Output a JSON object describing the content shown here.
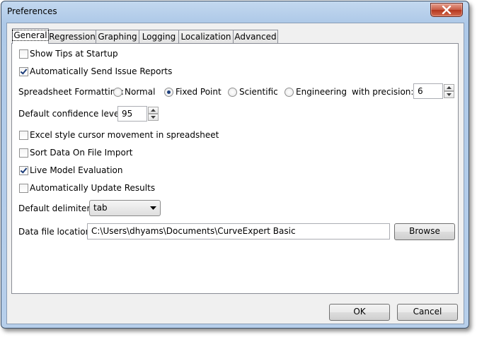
{
  "window": {
    "title": "Preferences"
  },
  "tabs": [
    {
      "label": "General",
      "active": true
    },
    {
      "label": "Regression",
      "active": false
    },
    {
      "label": "Graphing",
      "active": false
    },
    {
      "label": "Logging",
      "active": false
    },
    {
      "label": "Localization",
      "active": false
    },
    {
      "label": "Advanced",
      "active": false
    }
  ],
  "general": {
    "show_tips": {
      "label": "Show Tips at Startup",
      "checked": false
    },
    "send_reports": {
      "label": "Automatically Send Issue Reports",
      "checked": true
    },
    "spreadsheet_formatting": {
      "label": "Spreadsheet Formatting:",
      "options": [
        {
          "label": "Normal",
          "selected": false
        },
        {
          "label": "Fixed Point",
          "selected": true
        },
        {
          "label": "Scientific",
          "selected": false
        },
        {
          "label": "Engineering",
          "selected": false
        }
      ],
      "precision_label": "with precision:",
      "precision_value": "6"
    },
    "confidence": {
      "label": "Default confidence level:",
      "value": "95"
    },
    "excel_cursor": {
      "label": "Excel style cursor movement in spreadsheet",
      "checked": false
    },
    "sort_data": {
      "label": "Sort Data On File Import",
      "checked": false
    },
    "live_model": {
      "label": "Live Model Evaluation",
      "checked": true
    },
    "auto_update": {
      "label": "Automatically Update Results",
      "checked": false
    },
    "delimiter": {
      "label": "Default delimiter:",
      "value": "tab"
    },
    "data_file": {
      "label": "Data file location:",
      "value": "C:\\Users\\dhyams\\Documents\\CurveExpert Basic",
      "browse_label": "Browse"
    }
  },
  "footer": {
    "ok_label": "OK",
    "cancel_label": "Cancel"
  },
  "icons": {
    "close": "close-icon",
    "spin_up": "spin-up-icon",
    "spin_down": "spin-down-icon",
    "dropdown": "chevron-down-icon"
  }
}
